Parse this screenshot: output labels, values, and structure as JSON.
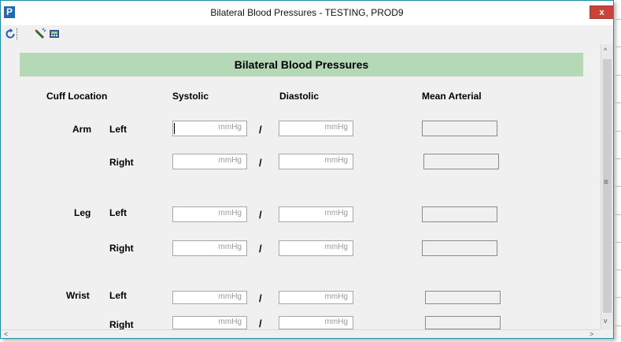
{
  "window": {
    "app_icon": "P",
    "title": "Bilateral Blood Pressures - TESTING, PROD9",
    "close_label": "x"
  },
  "toolbar": {
    "icons": [
      "refresh-icon",
      "edit-pen-icon",
      "calculator-icon"
    ]
  },
  "form": {
    "banner_title": "Bilateral Blood Pressures",
    "headers": {
      "cuff_location": "Cuff Location",
      "systolic": "Systolic",
      "diastolic": "Diastolic",
      "mean_arterial": "Mean Arterial"
    },
    "separator": "/",
    "unit_placeholder": "mmHg",
    "rows": [
      {
        "location": "Arm",
        "side": "Left",
        "systolic": "",
        "diastolic": "",
        "mean": ""
      },
      {
        "location": "",
        "side": "Right",
        "systolic": "",
        "diastolic": "",
        "mean": ""
      },
      {
        "location": "Leg",
        "side": "Left",
        "systolic": "",
        "diastolic": "",
        "mean": ""
      },
      {
        "location": "",
        "side": "Right",
        "systolic": "",
        "diastolic": "",
        "mean": ""
      },
      {
        "location": "Wrist",
        "side": "Left",
        "systolic": "",
        "diastolic": "",
        "mean": ""
      },
      {
        "location": "",
        "side": "Right",
        "systolic": "",
        "diastolic": "",
        "mean": ""
      }
    ]
  },
  "scrollbars": {
    "up": "^",
    "down": "v",
    "grip": "≡",
    "left": "<",
    "right": ">"
  }
}
